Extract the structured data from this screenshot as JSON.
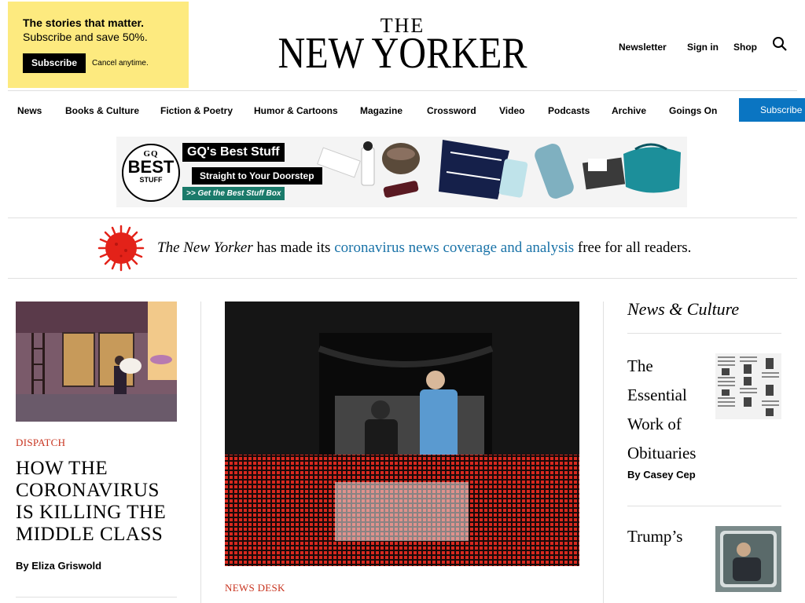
{
  "promo": {
    "line1": "The stories that matter.",
    "line2": "Subscribe and save 50%.",
    "button": "Subscribe",
    "cancel": "Cancel anytime."
  },
  "logo": {
    "top": "THE",
    "main": "NEW YORKER"
  },
  "header_links": {
    "newsletter": "Newsletter",
    "signin": "Sign in",
    "shop": "Shop"
  },
  "nav": {
    "items": [
      "News",
      "Books & Culture",
      "Fiction & Poetry",
      "Humor & Cartoons",
      "Magazine",
      "Crossword",
      "Video",
      "Podcasts",
      "Archive",
      "Goings On"
    ],
    "subscribe": "Subscribe"
  },
  "ad": {
    "badge_gq": "GQ",
    "badge_best": "BEST",
    "badge_stuff": "STUFF",
    "title": "GQ's Best Stuff",
    "subtitle": "Straight to Your Doorstep",
    "cta": ">> Get the Best Stuff Box"
  },
  "banner": {
    "pub": "The New Yorker",
    "text1": " has made its ",
    "link": "coronavirus news coverage and analysis",
    "text2": " free for all readers."
  },
  "left_story": {
    "rubric": "DISPATCH",
    "headline": "HOW THE CORONAVIRUS IS KILLING THE MIDDLE CLASS",
    "byline": "By Eliza Griswold"
  },
  "center_story": {
    "rubric": "NEWS DESK"
  },
  "right": {
    "section": "News & Culture",
    "story1": {
      "title": "The Essential Work of Obituaries",
      "byline": "By Casey Cep"
    },
    "story2": {
      "title": "Trump’s"
    }
  },
  "colors": {
    "accent_blue": "#0a75c2",
    "rubric_red": "#c8331e",
    "promo_yellow": "#fdea7f",
    "link_blue": "#1a73a8"
  }
}
